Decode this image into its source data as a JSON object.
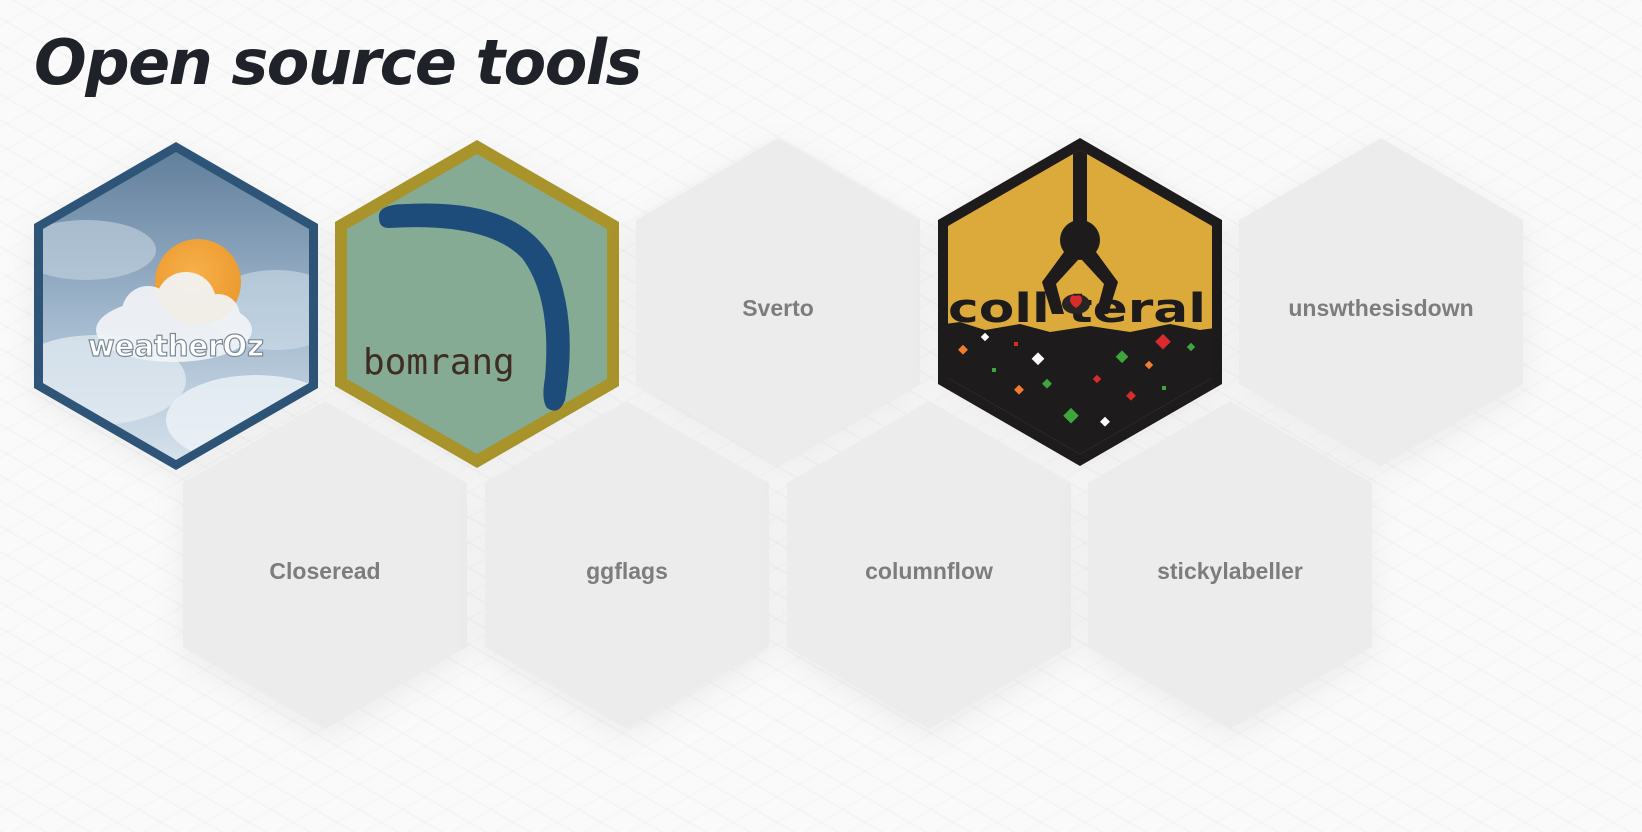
{
  "page": {
    "title": "Open source tools"
  },
  "tools": {
    "weatheroz": {
      "name": "weatherOz",
      "border_color": "#2e5578"
    },
    "bomrang": {
      "name": "bomrang",
      "border_color": "#a8942a",
      "fill_color": "#86ab94"
    },
    "sverto": {
      "name": "Sverto"
    },
    "collateral": {
      "name": "coll teral",
      "fill_color": "#dcaa3a",
      "border_color": "#1d1b1b"
    },
    "unswthesisdown": {
      "name": "unswthesisdown"
    },
    "closeread": {
      "name": "Closeread"
    },
    "ggflags": {
      "name": "ggflags"
    },
    "columnflow": {
      "name": "columnflow"
    },
    "stickylabeller": {
      "name": "stickylabeller"
    }
  },
  "colors": {
    "placeholder_hex": "#ececec",
    "placeholder_text": "#7d7d7d",
    "title": "#1f2229"
  }
}
